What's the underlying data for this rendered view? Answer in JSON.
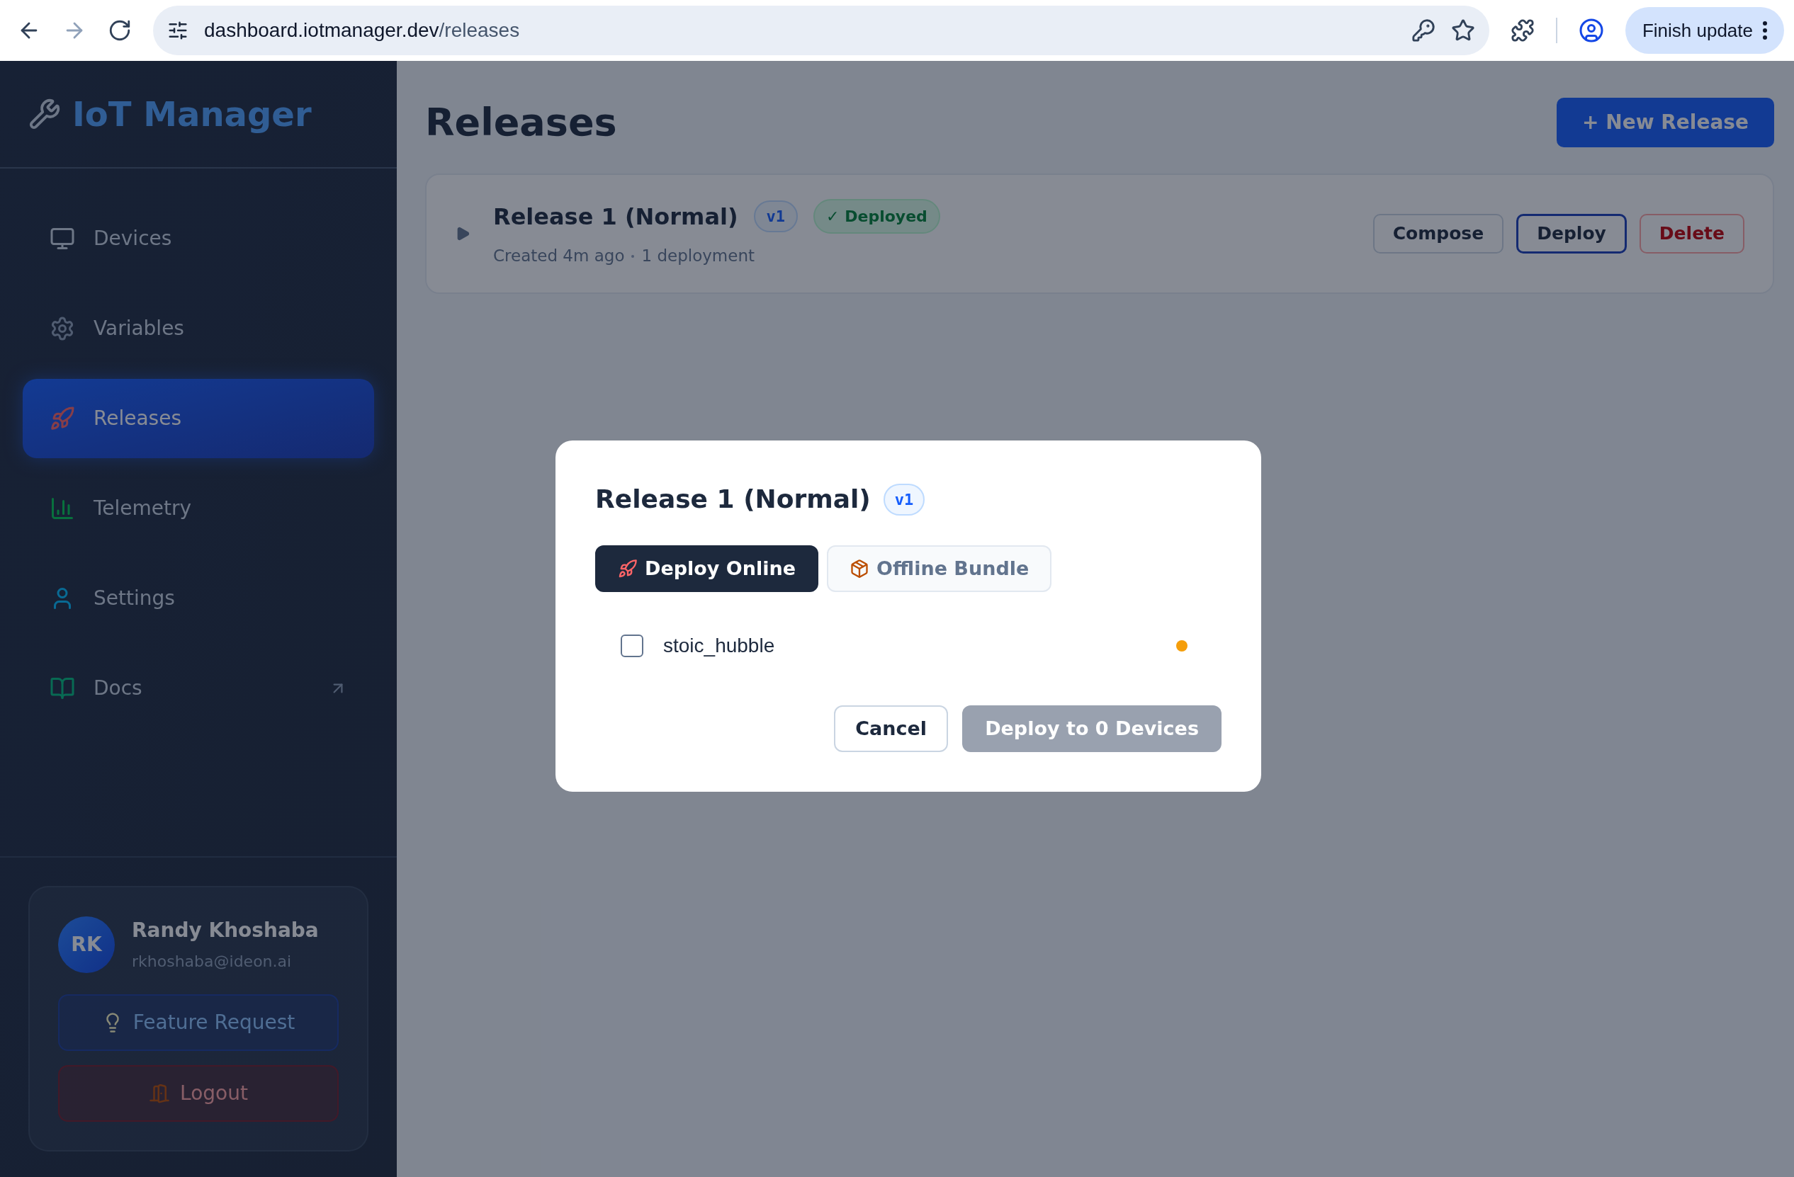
{
  "browser": {
    "url_host": "dashboard.iotmanager.dev",
    "url_path": "/releases",
    "update_button": "Finish update"
  },
  "sidebar": {
    "brand": "IoT Manager",
    "items": [
      {
        "label": "Devices",
        "selected": false,
        "external": false
      },
      {
        "label": "Variables",
        "selected": false,
        "external": false
      },
      {
        "label": "Releases",
        "selected": true,
        "external": false
      },
      {
        "label": "Telemetry",
        "selected": false,
        "external": false
      },
      {
        "label": "Settings",
        "selected": false,
        "external": false
      },
      {
        "label": "Docs",
        "selected": false,
        "external": true
      }
    ],
    "user": {
      "initials": "RK",
      "name": "Randy Khoshaba",
      "email": "rkhoshaba@ideon.ai"
    },
    "buttons": [
      {
        "label": "Feature Request",
        "kind": "feature"
      },
      {
        "label": "Logout",
        "kind": "logout"
      }
    ]
  },
  "page": {
    "title": "Releases",
    "new_button": "+ New Release",
    "releases": [
      {
        "name": "Release 1 (Normal)",
        "version": "v1",
        "status": "✓ Deployed",
        "created": "Created 4m ago",
        "deployments": "1 deployment",
        "expanded": false,
        "actions": [
          {
            "label": "Compose",
            "kind": "neutral"
          },
          {
            "label": "Deploy",
            "kind": "primary"
          },
          {
            "label": "Delete",
            "kind": "danger"
          }
        ]
      }
    ]
  },
  "modal": {
    "title": "Release 1 (Normal)",
    "version": "v1",
    "tabs": [
      {
        "label": "Deploy Online",
        "selected": true
      },
      {
        "label": "Offline Bundle",
        "selected": false
      }
    ],
    "devices": [
      {
        "name": "stoic_hubble",
        "checked": false,
        "color": "#f59e0b"
      }
    ],
    "cancel": "Cancel",
    "submit": {
      "label": "Deploy to 0 Devices",
      "disabled": true
    }
  }
}
